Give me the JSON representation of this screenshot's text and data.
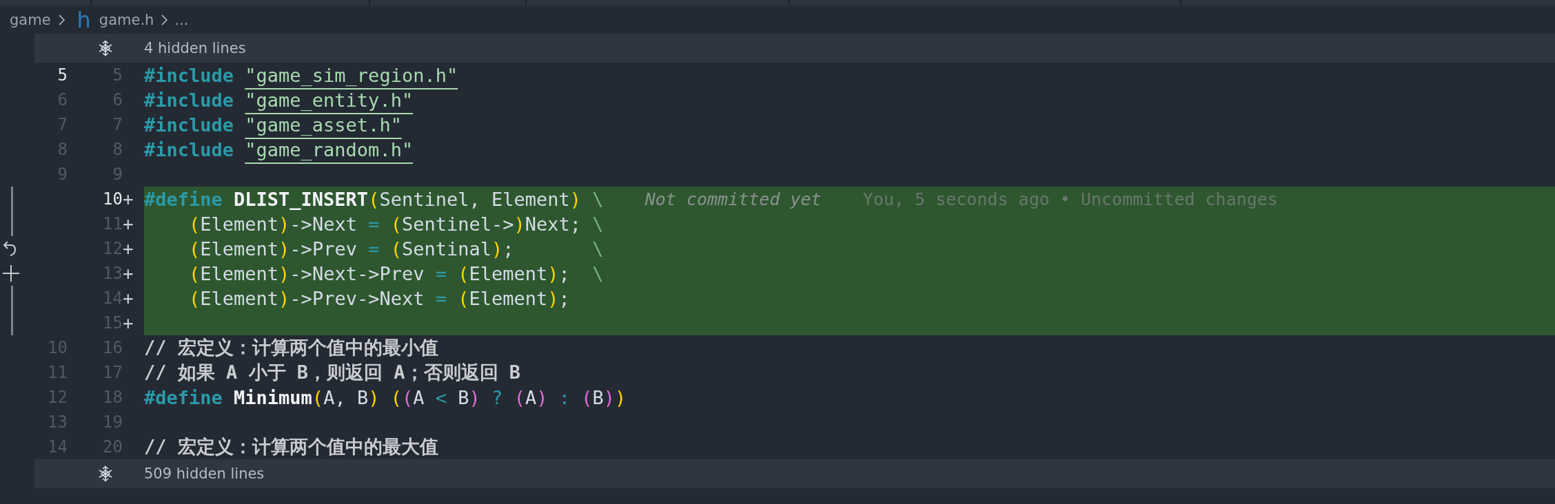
{
  "breadcrumb": [
    {
      "label": "game"
    },
    {
      "icon": "h",
      "label": "game.h"
    },
    {
      "label": "..."
    }
  ],
  "hidden_top": {
    "text": "4 hidden lines"
  },
  "lines": [
    {
      "kind": "context",
      "original": "5",
      "modified": "5",
      "active_original": true,
      "active_modified": false,
      "text": "#include \"game_sim_region.h\""
    },
    {
      "kind": "context",
      "original": "6",
      "modified": "6",
      "active_original": false,
      "active_modified": false,
      "text": "#include \"game_entity.h\""
    },
    {
      "kind": "context",
      "original": "7",
      "modified": "7",
      "active_original": false,
      "active_modified": false,
      "text": "#include \"game_asset.h\""
    },
    {
      "kind": "context",
      "original": "8",
      "modified": "8",
      "active_original": false,
      "active_modified": false,
      "text": "#include \"game_random.h\""
    },
    {
      "kind": "context",
      "original": "9",
      "modified": "9",
      "active_original": false,
      "active_modified": false
    },
    {
      "kind": "added",
      "modified": "10",
      "marker": "+",
      "active_modified": true,
      "text": "#define DLIST_INSERT(Sentinel, Element) \\",
      "blame": {
        "author": "Not committed yet",
        "detail": "You, 5 seconds ago • Uncommitted changes"
      }
    },
    {
      "kind": "added",
      "modified": "11",
      "marker": "+",
      "active_modified": false,
      "text": "    (Element)->Next = (Sentinel->)Next; \\"
    },
    {
      "kind": "revert",
      "modified": "12",
      "marker": "+",
      "active_modified": false,
      "text": "    (Element)->Prev = (Sentinal);       \\"
    },
    {
      "kind": "stage",
      "modified": "13",
      "marker": "+",
      "active_modified": false,
      "text": "    (Element)->Next->Prev = (Element);  \\"
    },
    {
      "kind": "added",
      "modified": "14",
      "marker": "+",
      "active_modified": false,
      "text": "    (Element)->Prev->Next = (Element);"
    },
    {
      "kind": "added",
      "modified": "15",
      "marker": "+",
      "active_modified": false
    },
    {
      "kind": "context",
      "original": "10",
      "modified": "16",
      "active_original": false,
      "active_modified": false,
      "text": "// 宏定义：计算两个值中的最小值"
    },
    {
      "kind": "context",
      "original": "11",
      "modified": "17",
      "active_original": false,
      "active_modified": false,
      "text": "// 如果 A 小于 B，则返回 A；否则返回 B"
    },
    {
      "kind": "context",
      "original": "12",
      "modified": "18",
      "active_original": false,
      "active_modified": false,
      "text": "#define Minimum(A, B) ((A < B) ? (A) : (B))"
    },
    {
      "kind": "context",
      "original": "13",
      "modified": "19",
      "active_original": false,
      "active_modified": false
    },
    {
      "kind": "context",
      "original": "14",
      "modified": "20",
      "active_original": false,
      "active_modified": false,
      "text": "// 宏定义：计算两个值中的最大值"
    }
  ],
  "hidden_bottom": {
    "text": "509 hidden lines"
  }
}
